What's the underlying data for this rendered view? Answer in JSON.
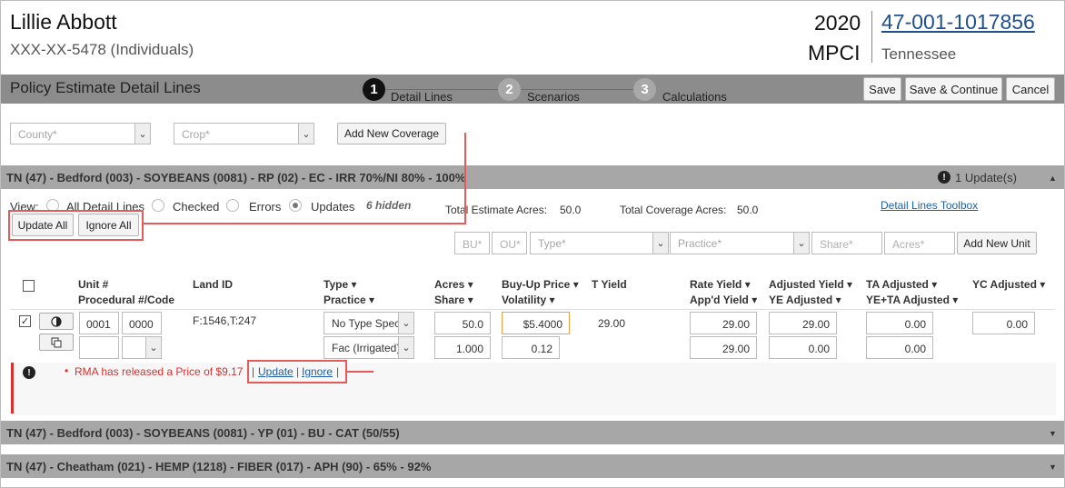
{
  "header": {
    "insured_name": "Lillie Abbott",
    "insured_id": "XXX-XX-5478 (Individuals)",
    "year": "2020",
    "program": "MPCI",
    "policy_number": "47-001-1017856",
    "state": "Tennessee"
  },
  "titlebar": {
    "title": "Policy Estimate Detail Lines",
    "steps": [
      {
        "num": "1",
        "label": "Detail Lines",
        "active": true
      },
      {
        "num": "2",
        "label": "Scenarios",
        "active": false
      },
      {
        "num": "3",
        "label": "Calculations",
        "active": false
      }
    ],
    "save_label": "Save",
    "save_continue_label": "Save & Continue",
    "cancel_label": "Cancel"
  },
  "filters": {
    "county_placeholder": "County*",
    "crop_placeholder": "Crop*",
    "add_coverage_label": "Add New Coverage"
  },
  "groups": [
    {
      "title": "TN (47) - Bedford (003) - SOYBEANS (0081) - RP (02) - EC - IRR 70%/NI 80% - 100%",
      "updates": "1 Update(s)",
      "expanded": true
    },
    {
      "title": "TN (47) - Bedford (003) - SOYBEANS (0081) - YP (01) - BU - CAT (50/55)",
      "expanded": false
    },
    {
      "title": "TN (47) - Cheatham (021) - HEMP (1218) - FIBER (017) - APH (90) - 65% - 92%",
      "expanded": false
    }
  ],
  "view": {
    "label": "View:",
    "options": [
      "All Detail Lines",
      "Checked",
      "Errors",
      "Updates"
    ],
    "selected": "Updates",
    "hidden_count": "6 hidden",
    "total_estimate_label": "Total Estimate Acres:",
    "total_estimate_value": "50.0",
    "total_coverage_label": "Total Coverage Acres:",
    "total_coverage_value": "50.0",
    "toolbox_link": "Detail Lines Toolbox",
    "update_all_label": "Update All",
    "ignore_all_label": "Ignore All"
  },
  "add_unit": {
    "bu_placeholder": "BU*",
    "ou_placeholder": "OU*",
    "type_placeholder": "Type*",
    "practice_placeholder": "Practice*",
    "share_placeholder": "Share*",
    "acres_placeholder": "Acres*",
    "add_unit_label": "Add New Unit"
  },
  "columns": {
    "unit": "Unit #",
    "procedural": "Procedural #/Code",
    "land_id": "Land ID",
    "type": "Type",
    "practice": "Practice",
    "acres": "Acres",
    "share": "Share",
    "buyup": "Buy-Up Price",
    "volatility": "Volatility",
    "t_yield": "T Yield",
    "rate_yield": "Rate Yield",
    "appd_yield": "App'd Yield",
    "adjusted_yield": "Adjusted Yield",
    "ye_adjusted": "YE Adjusted",
    "ta_adjusted": "TA Adjusted",
    "ye_ta_adjusted": "YE+TA Adjusted",
    "yc_adjusted": "YC Adjusted"
  },
  "row": {
    "checked": true,
    "unit_num": "0001",
    "unit_sub": "0000",
    "land_id": "F:1546,T:247",
    "type": "No Type Specified",
    "practice": "Fac (Irrigated)",
    "acres": "50.0",
    "share": "1.000",
    "buyup_price": "$5.4000",
    "volatility": "0.12",
    "t_yield": "29.00",
    "rate_yield": "29.00",
    "appd_yield": "29.00",
    "adjusted_yield": "29.00",
    "ye_adjusted": "0.00",
    "ta_adjusted": "0.00",
    "ye_ta_adjusted": "0.00",
    "yc_adjusted": "0.00"
  },
  "alert": {
    "bullet": "•",
    "message": "RMA has released a Price of $9.17",
    "update_link": "Update",
    "ignore_link": "Ignore",
    "separator": "|"
  },
  "icons": {
    "info": "!",
    "caret_up": "▲",
    "caret_down": "▼",
    "select_arrow": "⌄",
    "sort_arrow": "▾",
    "check": "✓"
  },
  "colors": {
    "titlebar": "#8c8c8c",
    "groupbar": "#a7a7a7",
    "link": "#1f4f8f",
    "alert_red": "#d9302f",
    "highlight_outline": "#e55a5a",
    "focus_orange": "#f0a040"
  }
}
